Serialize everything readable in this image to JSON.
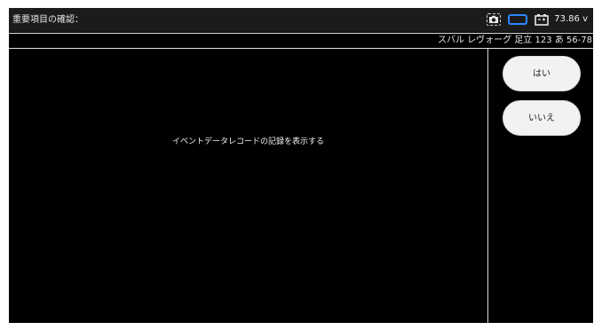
{
  "header": {
    "title": "重要項目の確認：",
    "voltage": "73.86 v",
    "icons": [
      "camera-icon",
      "vci-connection-icon",
      "battery-icon"
    ],
    "vci_color": "#2f86ff"
  },
  "vehicle": {
    "info": "スバル レヴォーグ 足立 123 あ 56-78"
  },
  "main": {
    "message": "イベントデータレコードの記録を表示する"
  },
  "actions": {
    "yes_label": "はい",
    "no_label": "いいえ"
  }
}
